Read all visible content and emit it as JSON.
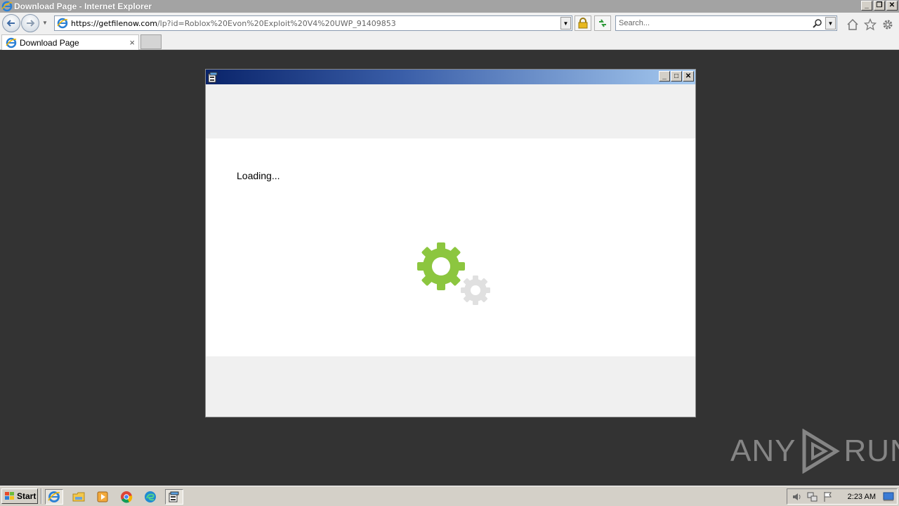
{
  "window": {
    "title": "Download Page - Internet Explorer"
  },
  "navbar": {
    "url_host": "https://getfilenow.com",
    "url_path": "/lp?id=Roblox%20Evon%20Exploit%20V4%20UWP_91409853",
    "search_placeholder": "Search..."
  },
  "tabs": [
    {
      "label": "Download Page",
      "close": "×"
    }
  ],
  "dialog": {
    "loading_text": "Loading..."
  },
  "colors": {
    "gear_primary": "#8cc63f",
    "gear_secondary": "#e0e0e0",
    "content_bg": "#333333",
    "dialog_title_start": "#0a246a",
    "dialog_title_end": "#a6caf0"
  },
  "watermark": {
    "left": "ANY",
    "right": "RUN"
  },
  "taskbar": {
    "start_label": "Start",
    "clock": "2:23 AM",
    "icons": [
      "ie-icon",
      "explorer-icon",
      "media-player-icon",
      "chrome-icon",
      "edge-icon",
      "installer-icon"
    ]
  }
}
